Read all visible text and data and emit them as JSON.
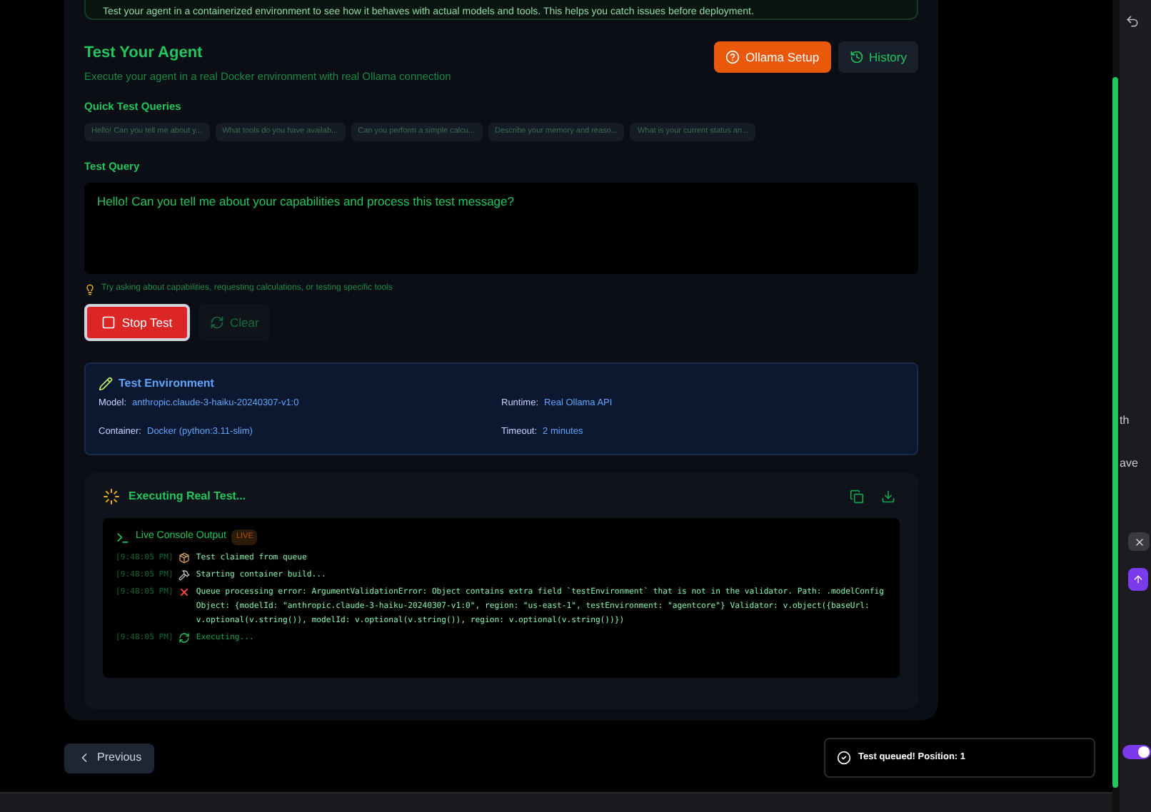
{
  "intro_card": {
    "text": "Test your agent in a containerized environment to see how it behaves with actual models and tools. This helps you catch issues before deployment."
  },
  "header": {
    "title": "Test Your Agent",
    "subtitle": "Execute your agent in a real Docker environment with real Ollama connection",
    "buttons": [
      {
        "label": "Ollama Setup",
        "kind": "primary"
      },
      {
        "label": "History",
        "kind": "secondary"
      }
    ]
  },
  "quick_queries": {
    "label": "Quick Test Queries",
    "items": [
      "Hello! Can you tell me about y...",
      "What tools do you have availab...",
      "Can you perform a simple calcu...",
      "Describe your memory and reaso...",
      "What is your current status an..."
    ]
  },
  "test_query": {
    "label": "Test Query",
    "value": "Hello! Can you tell me about your capabilities and process this test message?",
    "hint": "Try asking about capabilities, requesting calculations, or testing specific tools"
  },
  "actions": [
    {
      "label": "Stop Test",
      "kind": "stop",
      "disabled": false
    },
    {
      "label": "Clear",
      "kind": "clear",
      "disabled": true
    }
  ],
  "environment": {
    "title": "Test Environment",
    "fields": [
      {
        "label": "Model:",
        "value": "anthropic.claude-3-haiku-20240307-v1:0"
      },
      {
        "label": "Runtime:",
        "value": "Real Ollama API"
      },
      {
        "label": "Container:",
        "value": "Docker (python:3.11-slim)"
      },
      {
        "label": "Timeout:",
        "value": "2 minutes"
      }
    ]
  },
  "execution": {
    "title": "Executing Real Test...",
    "console_title": "Live Console Output",
    "badge": "LIVE",
    "lines": [
      {
        "time": "[9:48:05 PM]",
        "kind": "package",
        "text": "Test claimed from queue"
      },
      {
        "time": "[9:48:05 PM]",
        "kind": "build",
        "text": "Starting container build..."
      },
      {
        "time": "[9:48:05 PM]",
        "kind": "error",
        "text": "Queue processing error: ArgumentValidationError: Object contains extra field `testEnvironment` that is not in the validator. Path: .modelConfig Object: {modelId: \"anthropic.claude-3-haiku-20240307-v1:0\", region: \"us-east-1\", testEnvironment: \"agentcore\"} Validator: v.object({baseUrl: v.optional(v.string()), modelId: v.optional(v.string()), region: v.optional(v.string())})"
      },
      {
        "time": "[9:48:05 PM]",
        "kind": "running",
        "text": "Executing..."
      }
    ]
  },
  "footer": {
    "previous": "Previous",
    "toast": "Test queued! Position: 1"
  },
  "side_panel": {
    "fragments": [
      "th",
      "ave"
    ],
    "toggle": {
      "on": true
    }
  }
}
